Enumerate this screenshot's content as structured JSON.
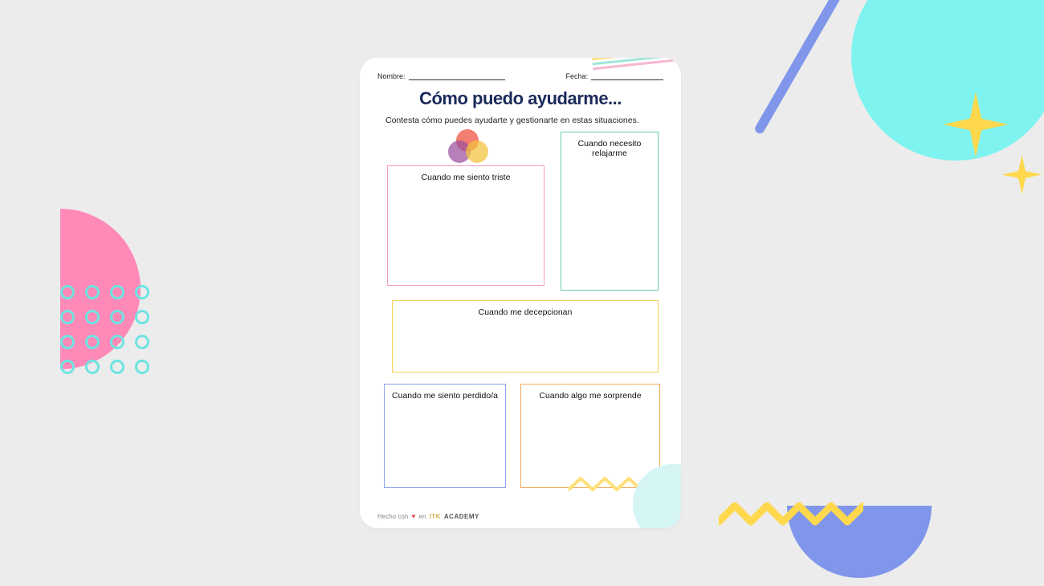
{
  "header": {
    "name_label": "Nombre:",
    "date_label": "Fecha:"
  },
  "title": "Cómo puedo ayudarme...",
  "subtitle": "Contesta cómo puedes ayudarte y gestionarte en estas situaciones.",
  "boxes": {
    "triste": "Cuando me siento triste",
    "relajarme": "Cuando necesito relajarme",
    "decepcionan": "Cuando me decepcionan",
    "perdido": "Cuando me siento perdido/a",
    "sorprende": "Cuando algo me sorprende"
  },
  "footer": {
    "made_with": "Hecho con",
    "in": "en",
    "brand_prefix": "ITK",
    "brand_suffix": "ACADEMY"
  },
  "colors": {
    "title": "#1b2a5b",
    "box_pink": "#f69fc0",
    "box_teal": "#6cc9b7",
    "box_yellow": "#f3cf4e",
    "box_blue": "#8aa2e8",
    "box_orange": "#f0a95a",
    "bg_cyan": "#7ff3f0",
    "bg_blue": "#7f96eb",
    "bg_pink": "#ff8ab7",
    "bg_yellow": "#ffd84d"
  }
}
